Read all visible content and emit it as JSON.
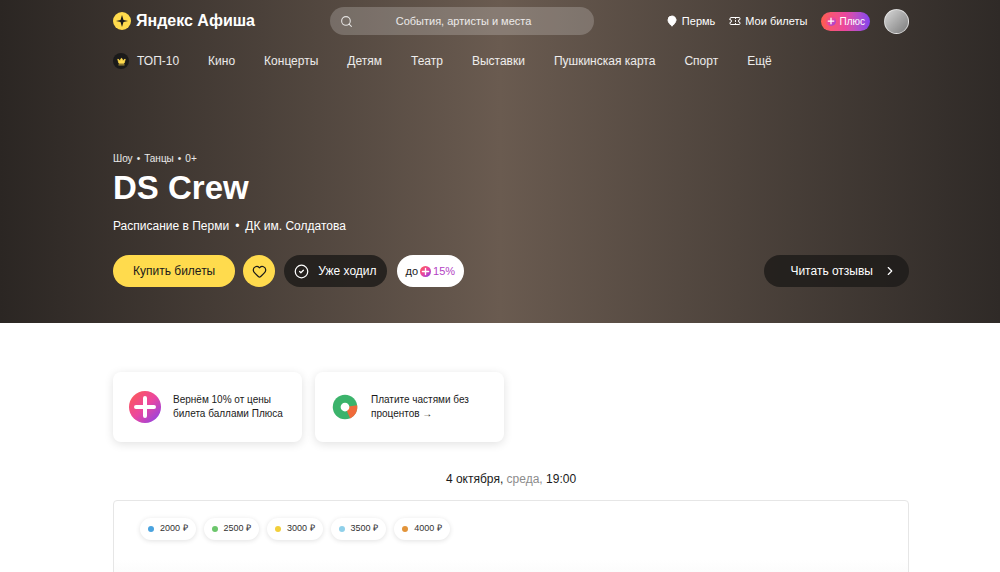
{
  "header": {
    "logo": "Яндекс Афиша",
    "search": {
      "placeholder": "События, артисты и места"
    },
    "city": "Пермь",
    "tickets": "Мои билеты",
    "plus": "Плюс"
  },
  "nav": [
    {
      "label": "ТОП-10",
      "selected": false,
      "kind": "top"
    },
    {
      "label": "Кино",
      "selected": false,
      "kind": "link"
    },
    {
      "label": "Концерты",
      "selected": false,
      "kind": "link"
    },
    {
      "label": "Детям",
      "selected": false,
      "kind": "link"
    },
    {
      "label": "Театр",
      "selected": false,
      "kind": "link"
    },
    {
      "label": "Выставки",
      "selected": false,
      "kind": "link"
    },
    {
      "label": "Пушкинская карта",
      "selected": false,
      "kind": "link"
    },
    {
      "label": "Спорт",
      "selected": false,
      "kind": "link"
    },
    {
      "label": "Ещё",
      "selected": false,
      "kind": "link"
    }
  ],
  "event": {
    "separator": "•",
    "tags": [
      "Шоу",
      "Танцы",
      "0+"
    ],
    "title": "DS Crew",
    "location": [
      "Расписание в Перми",
      "ДК им. Солдатова"
    ],
    "buy": "Купить билеты",
    "favorite": {
      "liked": false
    },
    "been": {
      "label": "Уже ходил",
      "checked": false
    },
    "cashback": {
      "prefix": "до",
      "value": "15%"
    },
    "reviews": "Читать отзывы"
  },
  "promos": [
    {
      "text": "Вернём 10% от цены билета баллами Плюса",
      "kind": "plus"
    },
    {
      "text": "Платите частями без процентов →",
      "kind": "split"
    }
  ],
  "session": {
    "date": "4 октября,",
    "weekday": "среда,",
    "time": "19:00"
  },
  "prices": [
    {
      "label": "2000 ₽",
      "color": "#4aa3df"
    },
    {
      "label": "2500 ₽",
      "color": "#6cc66c"
    },
    {
      "label": "3000 ₽",
      "color": "#f2cf3a"
    },
    {
      "label": "3500 ₽",
      "color": "#8fd0ea"
    },
    {
      "label": "4000 ₽",
      "color": "#e2943a"
    }
  ]
}
